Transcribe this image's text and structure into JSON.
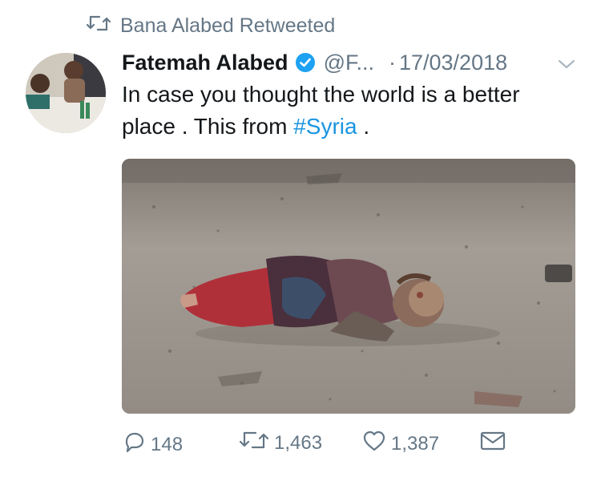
{
  "retweet_context": {
    "text": "Bana Alabed Retweeted",
    "icon": "retweet-icon"
  },
  "tweet": {
    "author_name": "Fatemah Alabed",
    "verified": true,
    "handle": "@F...",
    "separator": "·",
    "date": "17/03/2018",
    "text_part1": "In case you thought the world is a better place . This from ",
    "hashtag": "#Syria",
    "text_part2": " ."
  },
  "actions": {
    "reply_count": "148",
    "retweet_count": "1,463",
    "like_count": "1,387"
  },
  "colors": {
    "secondary_text": "#657786",
    "link": "#1b95e0",
    "verified_badge": "#1da1f2"
  }
}
